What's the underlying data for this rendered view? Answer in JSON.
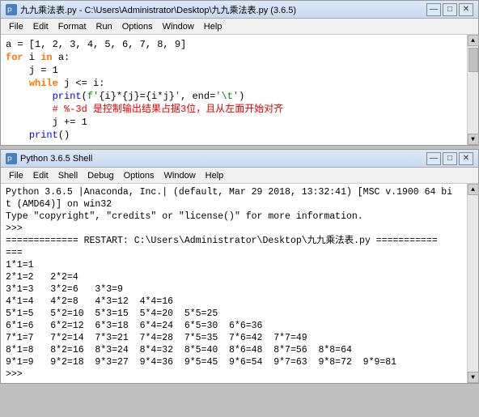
{
  "editor_window": {
    "title": "九九乘法表.py - C:\\Users\\Administrator\\Desktop\\九九乘法表.py (3.6.5)",
    "icon": "py",
    "menu": [
      "File",
      "Edit",
      "Format",
      "Run",
      "Options",
      "Window",
      "Help"
    ],
    "code_lines": [
      "a = [1, 2, 3, 4, 5, 6, 7, 8, 9]",
      "for i in a:",
      "    j = 1",
      "    while j <= i:",
      "        print(f'{i}*{j}={i*j}', end='\\t')",
      "        # %-3d 是控制输出结果占据3位，且从左面开始对齐",
      "        j += 1",
      "    print()"
    ]
  },
  "shell_window": {
    "title": "Python 3.6.5 Shell",
    "icon": "py",
    "menu": [
      "File",
      "Edit",
      "Shell",
      "Debug",
      "Options",
      "Window",
      "Help"
    ],
    "output_lines": [
      "Python 3.6.5 |Anaconda, Inc.| (default, Mar 29 2018, 13:32:41) [MSC v.1900 64 bi",
      "t (AMD64)] on win32",
      "Type \"copyright\", \"credits\" or \"license()\" for more information.",
      ">>> ",
      "============= RESTART: C:\\Users\\Administrator\\Desktop\\九九乘法表.py ===========",
      "===",
      "1*1=1",
      "2*1=2\t2*2=4",
      "3*1=3\t3*2=6\t3*3=9",
      "4*1=4\t4*2=8\t4*3=12\t4*4=16",
      "5*1=5\t5*2=10\t5*3=15\t5*4=20\t5*5=25",
      "6*1=6\t6*2=12\t6*3=18\t6*4=24\t6*5=30\t6*6=36",
      "7*1=7\t7*2=14\t7*3=21\t7*4=28\t7*5=35\t7*6=42\t7*7=49",
      "8*1=8\t8*2=16\t8*3=24\t8*4=32\t8*5=40\t8*6=48\t8*7=56\t8*8=64",
      "9*1=9\t9*2=18\t9*3=27\t9*4=36\t9*5=45\t9*6=54\t9*7=63\t9*8=72\t9*9=81",
      ">>> "
    ]
  },
  "controls": {
    "minimize": "—",
    "maximize": "□",
    "close": "✕"
  }
}
